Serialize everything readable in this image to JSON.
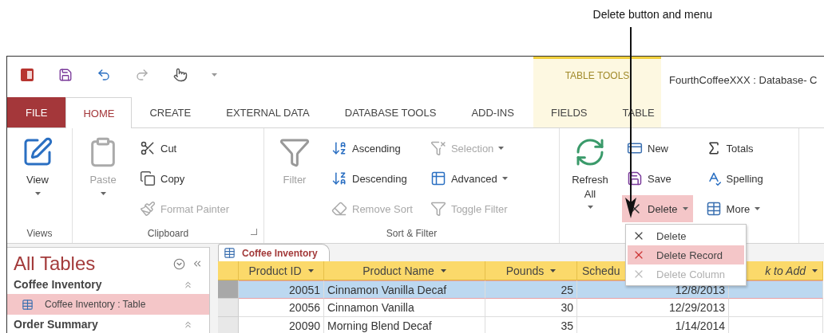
{
  "annotation": {
    "text": "Delete button and menu"
  },
  "window": {
    "title": "FourthCoffeeXXX : Database- C",
    "context_label": "TABLE TOOLS"
  },
  "tabs": [
    {
      "label": "FILE",
      "kind": "file",
      "selected": false
    },
    {
      "label": "HOME",
      "kind": "tab",
      "selected": true
    },
    {
      "label": "CREATE",
      "kind": "tab",
      "selected": false
    },
    {
      "label": "EXTERNAL DATA",
      "kind": "tab",
      "selected": false
    },
    {
      "label": "DATABASE TOOLS",
      "kind": "tab",
      "selected": false
    },
    {
      "label": "ADD-INS",
      "kind": "tab",
      "selected": false
    },
    {
      "label": "FIELDS",
      "kind": "context",
      "selected": false
    },
    {
      "label": "TABLE",
      "kind": "context",
      "selected": false
    }
  ],
  "ribbon": {
    "groups": [
      {
        "label": "Views",
        "columns": [
          {
            "kind": "large",
            "items": [
              {
                "label": "View",
                "disabled": false,
                "dropdown": true
              }
            ]
          }
        ]
      },
      {
        "label": "Clipboard",
        "launcher": true,
        "columns": [
          {
            "kind": "large",
            "items": [
              {
                "label": "Paste",
                "disabled": true,
                "dropdown": true
              }
            ]
          },
          {
            "kind": "small",
            "items": [
              {
                "label": "Cut",
                "disabled": false,
                "dropdown": false,
                "active": false
              },
              {
                "label": "Copy",
                "disabled": false,
                "dropdown": false,
                "active": false
              },
              {
                "label": "Format Painter",
                "disabled": true,
                "dropdown": false,
                "active": false
              }
            ]
          }
        ]
      },
      {
        "label": "Sort & Filter",
        "columns": [
          {
            "kind": "large",
            "items": [
              {
                "label": "Filter",
                "disabled": true,
                "dropdown": false
              }
            ]
          },
          {
            "kind": "small",
            "items": [
              {
                "label": "Ascending",
                "disabled": false,
                "dropdown": false,
                "active": false
              },
              {
                "label": "Descending",
                "disabled": false,
                "dropdown": false,
                "active": false
              },
              {
                "label": "Remove Sort",
                "disabled": true,
                "dropdown": false,
                "active": false
              }
            ]
          },
          {
            "kind": "small",
            "items": [
              {
                "label": "Selection",
                "disabled": true,
                "dropdown": true,
                "active": false
              },
              {
                "label": "Advanced",
                "disabled": false,
                "dropdown": true,
                "active": false
              },
              {
                "label": "Toggle Filter",
                "disabled": true,
                "dropdown": false,
                "active": false
              }
            ]
          }
        ]
      },
      {
        "columns": [
          {
            "kind": "large",
            "items": [
              {
                "label": "Refresh All",
                "disabled": false,
                "dropdown": true
              }
            ]
          },
          {
            "kind": "small",
            "items": [
              {
                "label": "New",
                "disabled": false,
                "dropdown": false,
                "active": false
              },
              {
                "label": "Save",
                "disabled": false,
                "dropdown": false,
                "active": false
              },
              {
                "label": "Delete",
                "disabled": false,
                "dropdown": true,
                "active": true
              }
            ]
          },
          {
            "kind": "small",
            "items": [
              {
                "label": "Totals",
                "disabled": false,
                "dropdown": false,
                "active": false
              },
              {
                "label": "Spelling",
                "disabled": false,
                "dropdown": false,
                "active": false
              },
              {
                "label": "More",
                "disabled": false,
                "dropdown": true,
                "active": false
              }
            ]
          }
        ]
      }
    ]
  },
  "delete_menu": [
    {
      "label": "Delete",
      "highlighted": false,
      "disabled": false
    },
    {
      "label": "Delete Record",
      "highlighted": true,
      "disabled": false
    },
    {
      "label": "Delete Column",
      "highlighted": false,
      "disabled": true
    }
  ],
  "navigation": {
    "title": "All Tables",
    "groups": [
      {
        "label": "Coffee Inventory",
        "items": [
          {
            "label": "Coffee Inventory : Table",
            "selected": true
          }
        ]
      },
      {
        "label": "Order Summary"
      }
    ]
  },
  "document_tab": {
    "label": "Coffee Inventory"
  },
  "table": {
    "columns": [
      {
        "label": "Product ID",
        "dropdown": true,
        "italic": false
      },
      {
        "label": "Product Name",
        "dropdown": true,
        "italic": false
      },
      {
        "label": "Pounds",
        "dropdown": true,
        "italic": false
      },
      {
        "label": "Schedu",
        "dropdown": false,
        "italic": false
      },
      {
        "label": "k to Add",
        "dropdown": true,
        "italic": true
      }
    ],
    "rows": [
      {
        "selected": true,
        "cells": [
          "20051",
          "Cinnamon Vanilla Decaf",
          "25",
          "12/8/2013",
          ""
        ]
      },
      {
        "selected": false,
        "cells": [
          "20056",
          "Cinnamon Vanilla",
          "30",
          "12/29/2013",
          ""
        ]
      },
      {
        "selected": false,
        "cells": [
          "20090",
          "Morning Blend Decaf",
          "35",
          "1/14/2014",
          ""
        ]
      }
    ]
  }
}
